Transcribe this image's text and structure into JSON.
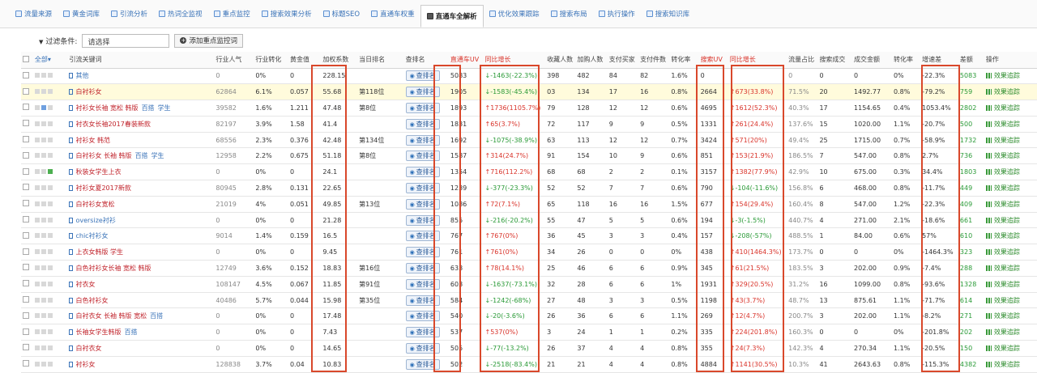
{
  "tabs": [
    {
      "label": "流量来源",
      "active": false
    },
    {
      "label": "黄金词库",
      "active": false
    },
    {
      "label": "引流分析",
      "active": false
    },
    {
      "label": "热词全监视",
      "active": false
    },
    {
      "label": "重点监控",
      "active": false
    },
    {
      "label": "搜索效果分析",
      "active": false
    },
    {
      "label": "标题SEO",
      "active": false
    },
    {
      "label": "直通车权重",
      "active": false
    },
    {
      "label": "直通车全解析",
      "active": true
    },
    {
      "label": "优化效果跟踪",
      "active": false
    },
    {
      "label": "搜索布局",
      "active": false
    },
    {
      "label": "执行操作",
      "active": false
    },
    {
      "label": "搜索知识库",
      "active": false
    }
  ],
  "filter": {
    "label": "过滤条件:",
    "select_value": "请选择",
    "add_button": "添加重点监控词"
  },
  "table": {
    "headers": [
      "全部",
      "引流关键词",
      "行业人气",
      "行业转化",
      "黄金值",
      "加权系数",
      "当日排名",
      "查排名",
      "直通车UV",
      "同比增长",
      "收藏人数",
      "加购人数",
      "支付买家",
      "支付件数",
      "转化率",
      "搜索UV",
      "同比增长",
      "流量占比",
      "搜索成交",
      "成交金额",
      "转化率",
      "增速差",
      "差额",
      "操作"
    ],
    "rank_button": "查排名",
    "op_label": "效果追踪",
    "rows": [
      {
        "kw": "其他",
        "kw_blue": true,
        "pop": "0",
        "conv": "0%",
        "gold": "0",
        "weight": "228.15",
        "rank": "",
        "uv": "5083",
        "uv_chg": "↓-1463(-22.3%)",
        "uv_up": false,
        "fav": "398",
        "cart": "482",
        "buyers": "84",
        "pieces": "82",
        "cvr": "1.6%",
        "suv": "0",
        "suv_chg": "",
        "suv_up": false,
        "share": "0",
        "sdeal": "0",
        "amount": "0",
        "cvr2": "0%",
        "speed": "-22.3%",
        "diff": "5083",
        "tags": [],
        "hl": false
      },
      {
        "kw": "白衬衫女",
        "kw_blue": false,
        "pop": "62864",
        "conv": "6.1%",
        "gold": "0.057",
        "weight": "55.68",
        "rank": "第118位",
        "uv": "1905",
        "uv_chg": "↓-1583(-45.4%)",
        "uv_up": false,
        "fav": "03",
        "cart": "134",
        "buyers": "17",
        "pieces": "16",
        "cvr": "0.8%",
        "suv": "2664",
        "suv_chg": "↑673(33.8%)",
        "suv_up": true,
        "share": "71.5%",
        "sdeal": "20",
        "amount": "1492.77",
        "cvr2": "0.8%",
        "speed": "-79.2%",
        "diff": "759",
        "tags": [],
        "hl": true
      },
      {
        "kw": "衬衫女长袖 宽松 韩版",
        "kw_blue": false,
        "pop": "39582",
        "conv": "1.6%",
        "gold": "1.211",
        "weight": "47.48",
        "rank": "第8位",
        "uv": "1893",
        "uv_chg": "↑1736(1105.7%)",
        "uv_up": true,
        "fav": "79",
        "cart": "128",
        "buyers": "12",
        "pieces": "12",
        "cvr": "0.6%",
        "suv": "4695",
        "suv_chg": "↑1612(52.3%)",
        "suv_up": true,
        "share": "40.3%",
        "sdeal": "17",
        "amount": "1154.65",
        "cvr2": "0.4%",
        "speed": "1053.4%",
        "diff": "2802",
        "tags": [
          "百搭",
          "学生"
        ],
        "hl": false
      },
      {
        "kw": "衬衣女长袖2017春装新款",
        "kw_blue": false,
        "pop": "82197",
        "conv": "3.9%",
        "gold": "1.58",
        "weight": "41.4",
        "rank": "",
        "uv": "1831",
        "uv_chg": "↑65(3.7%)",
        "uv_up": true,
        "fav": "72",
        "cart": "117",
        "buyers": "9",
        "pieces": "9",
        "cvr": "0.5%",
        "suv": "1331",
        "suv_chg": "↑261(24.4%)",
        "suv_up": true,
        "share": "137.6%",
        "sdeal": "15",
        "amount": "1020.00",
        "cvr2": "1.1%",
        "speed": "-20.7%",
        "diff": "500",
        "tags": [],
        "hl": false
      },
      {
        "kw": "衬衫女 韩范",
        "kw_blue": false,
        "pop": "68556",
        "conv": "2.3%",
        "gold": "0.376",
        "weight": "42.48",
        "rank": "第134位",
        "uv": "1692",
        "uv_chg": "↓-1075(-38.9%)",
        "uv_up": false,
        "fav": "63",
        "cart": "113",
        "buyers": "12",
        "pieces": "12",
        "cvr": "0.7%",
        "suv": "3424",
        "suv_chg": "↑571(20%)",
        "suv_up": true,
        "share": "49.4%",
        "sdeal": "25",
        "amount": "1715.00",
        "cvr2": "0.7%",
        "speed": "-58.9%",
        "diff": "1732",
        "tags": [],
        "hl": false
      },
      {
        "kw": "白衬衫女 长袖 韩版",
        "kw_blue": false,
        "pop": "12958",
        "conv": "2.2%",
        "gold": "0.675",
        "weight": "51.18",
        "rank": "第8位",
        "uv": "1587",
        "uv_chg": "↑314(24.7%)",
        "uv_up": true,
        "fav": "91",
        "cart": "154",
        "buyers": "10",
        "pieces": "9",
        "cvr": "0.6%",
        "suv": "851",
        "suv_chg": "↑153(21.9%)",
        "suv_up": true,
        "share": "186.5%",
        "sdeal": "7",
        "amount": "547.00",
        "cvr2": "0.8%",
        "speed": "2.7%",
        "diff": "736",
        "tags": [
          "百搭",
          "学生"
        ],
        "hl": false
      },
      {
        "kw": "秋装女学生上衣",
        "kw_blue": false,
        "pop": "0",
        "conv": "0%",
        "gold": "0",
        "weight": "24.1",
        "rank": "",
        "uv": "1354",
        "uv_chg": "↑716(112.2%)",
        "uv_up": true,
        "fav": "68",
        "cart": "68",
        "buyers": "2",
        "pieces": "2",
        "cvr": "0.1%",
        "suv": "3157",
        "suv_chg": "↑1382(77.9%)",
        "suv_up": true,
        "share": "42.9%",
        "sdeal": "10",
        "amount": "675.00",
        "cvr2": "0.3%",
        "speed": "34.4%",
        "diff": "1803",
        "tags": [],
        "hl": false
      },
      {
        "kw": "衬衫女夏2017新款",
        "kw_blue": false,
        "pop": "80945",
        "conv": "2.8%",
        "gold": "0.131",
        "weight": "22.65",
        "rank": "",
        "uv": "1239",
        "uv_chg": "↓-377(-23.3%)",
        "uv_up": false,
        "fav": "52",
        "cart": "52",
        "buyers": "7",
        "pieces": "7",
        "cvr": "0.6%",
        "suv": "790",
        "suv_chg": "↓-104(-11.6%)",
        "suv_up": false,
        "share": "156.8%",
        "sdeal": "6",
        "amount": "468.00",
        "cvr2": "0.8%",
        "speed": "-11.7%",
        "diff": "449",
        "tags": [],
        "hl": false
      },
      {
        "kw": "白衬衫女宽松",
        "kw_blue": false,
        "pop": "21019",
        "conv": "4%",
        "gold": "0.051",
        "weight": "49.85",
        "rank": "第13位",
        "uv": "1086",
        "uv_chg": "↑72(7.1%)",
        "uv_up": true,
        "fav": "65",
        "cart": "118",
        "buyers": "16",
        "pieces": "16",
        "cvr": "1.5%",
        "suv": "677",
        "suv_chg": "↑154(29.4%)",
        "suv_up": true,
        "share": "160.4%",
        "sdeal": "8",
        "amount": "547.00",
        "cvr2": "1.2%",
        "speed": "-22.3%",
        "diff": "409",
        "tags": [],
        "hl": false
      },
      {
        "kw": "oversize衬衫",
        "kw_blue": true,
        "pop": "0",
        "conv": "0%",
        "gold": "0",
        "weight": "21.28",
        "rank": "",
        "uv": "855",
        "uv_chg": "↓-216(-20.2%)",
        "uv_up": false,
        "fav": "55",
        "cart": "47",
        "buyers": "5",
        "pieces": "5",
        "cvr": "0.6%",
        "suv": "194",
        "suv_chg": "↓-3(-1.5%)",
        "suv_up": false,
        "share": "440.7%",
        "sdeal": "4",
        "amount": "271.00",
        "cvr2": "2.1%",
        "speed": "-18.6%",
        "diff": "661",
        "tags": [],
        "hl": false
      },
      {
        "kw": "chic衬衫女",
        "kw_blue": true,
        "pop": "9014",
        "conv": "1.4%",
        "gold": "0.159",
        "weight": "16.5",
        "rank": "",
        "uv": "767",
        "uv_chg": "↑767(0%)",
        "uv_up": true,
        "fav": "36",
        "cart": "45",
        "buyers": "3",
        "pieces": "3",
        "cvr": "0.4%",
        "suv": "157",
        "suv_chg": "↓-208(-57%)",
        "suv_up": false,
        "share": "488.5%",
        "sdeal": "1",
        "amount": "84.00",
        "cvr2": "0.6%",
        "speed": "57%",
        "diff": "610",
        "tags": [],
        "hl": false
      },
      {
        "kw": "上衣女韩版 学生",
        "kw_blue": false,
        "pop": "0",
        "conv": "0%",
        "gold": "0",
        "weight": "9.45",
        "rank": "",
        "uv": "761",
        "uv_chg": "↑761(0%)",
        "uv_up": true,
        "fav": "34",
        "cart": "26",
        "buyers": "0",
        "pieces": "0",
        "cvr": "0%",
        "suv": "438",
        "suv_chg": "↑410(1464.3%)",
        "suv_up": true,
        "share": "173.7%",
        "sdeal": "0",
        "amount": "0",
        "cvr2": "0%",
        "speed": "-1464.3%",
        "diff": "323",
        "tags": [],
        "hl": false
      },
      {
        "kw": "白色衬衫女长袖 宽松 韩版",
        "kw_blue": false,
        "pop": "12749",
        "conv": "3.6%",
        "gold": "0.152",
        "weight": "18.83",
        "rank": "第16位",
        "uv": "633",
        "uv_chg": "↑78(14.1%)",
        "uv_up": true,
        "fav": "25",
        "cart": "46",
        "buyers": "6",
        "pieces": "6",
        "cvr": "0.9%",
        "suv": "345",
        "suv_chg": "↑61(21.5%)",
        "suv_up": true,
        "share": "183.5%",
        "sdeal": "3",
        "amount": "202.00",
        "cvr2": "0.9%",
        "speed": "-7.4%",
        "diff": "288",
        "tags": [],
        "hl": false
      },
      {
        "kw": "衬衣女",
        "kw_blue": false,
        "pop": "108147",
        "conv": "4.5%",
        "gold": "0.067",
        "weight": "11.85",
        "rank": "第91位",
        "uv": "603",
        "uv_chg": "↓-1637(-73.1%)",
        "uv_up": false,
        "fav": "32",
        "cart": "28",
        "buyers": "6",
        "pieces": "6",
        "cvr": "1%",
        "suv": "1931",
        "suv_chg": "↑329(20.5%)",
        "suv_up": true,
        "share": "31.2%",
        "sdeal": "16",
        "amount": "1099.00",
        "cvr2": "0.8%",
        "speed": "-93.6%",
        "diff": "1328",
        "tags": [],
        "hl": false
      },
      {
        "kw": "白色衬衫女",
        "kw_blue": false,
        "pop": "40486",
        "conv": "5.7%",
        "gold": "0.044",
        "weight": "15.98",
        "rank": "第35位",
        "uv": "584",
        "uv_chg": "↓-1242(-68%)",
        "uv_up": false,
        "fav": "27",
        "cart": "48",
        "buyers": "3",
        "pieces": "3",
        "cvr": "0.5%",
        "suv": "1198",
        "suv_chg": "↑43(3.7%)",
        "suv_up": true,
        "share": "48.7%",
        "sdeal": "13",
        "amount": "875.61",
        "cvr2": "1.1%",
        "speed": "-71.7%",
        "diff": "614",
        "tags": [],
        "hl": false
      },
      {
        "kw": "白衬衣女 长袖 韩版 宽松",
        "kw_blue": false,
        "pop": "0",
        "conv": "0%",
        "gold": "0",
        "weight": "17.48",
        "rank": "",
        "uv": "540",
        "uv_chg": "↓-20(-3.6%)",
        "uv_up": false,
        "fav": "26",
        "cart": "36",
        "buyers": "6",
        "pieces": "6",
        "cvr": "1.1%",
        "suv": "269",
        "suv_chg": "↑12(4.7%)",
        "suv_up": true,
        "share": "200.7%",
        "sdeal": "3",
        "amount": "202.00",
        "cvr2": "1.1%",
        "speed": "-8.2%",
        "diff": "271",
        "tags": [
          "百搭"
        ],
        "hl": false
      },
      {
        "kw": "长袖女学生韩版",
        "kw_blue": false,
        "pop": "0",
        "conv": "0%",
        "gold": "0",
        "weight": "7.43",
        "rank": "",
        "uv": "537",
        "uv_chg": "↑537(0%)",
        "uv_up": true,
        "fav": "3",
        "cart": "24",
        "buyers": "1",
        "pieces": "1",
        "cvr": "0.2%",
        "suv": "335",
        "suv_chg": "↑224(201.8%)",
        "suv_up": true,
        "share": "160.3%",
        "sdeal": "0",
        "amount": "0",
        "cvr2": "0%",
        "speed": "-201.8%",
        "diff": "202",
        "tags": [
          "百搭"
        ],
        "hl": false
      },
      {
        "kw": "白衬衣女",
        "kw_blue": false,
        "pop": "0",
        "conv": "0%",
        "gold": "0",
        "weight": "14.65",
        "rank": "",
        "uv": "505",
        "uv_chg": "↓-77(-13.2%)",
        "uv_up": false,
        "fav": "26",
        "cart": "37",
        "buyers": "4",
        "pieces": "4",
        "cvr": "0.8%",
        "suv": "355",
        "suv_chg": "↑24(7.3%)",
        "suv_up": true,
        "share": "142.3%",
        "sdeal": "4",
        "amount": "270.34",
        "cvr2": "1.1%",
        "speed": "-20.5%",
        "diff": "150",
        "tags": [],
        "hl": false
      },
      {
        "kw": "衬衫女",
        "kw_blue": false,
        "pop": "128838",
        "conv": "3.7%",
        "gold": "0.04",
        "weight": "10.83",
        "rank": "",
        "uv": "502",
        "uv_chg": "↓-2518(-83.4%)",
        "uv_up": false,
        "fav": "21",
        "cart": "21",
        "buyers": "4",
        "pieces": "4",
        "cvr": "0.8%",
        "suv": "4884",
        "suv_chg": "↑1141(30.5%)",
        "suv_up": true,
        "share": "10.3%",
        "sdeal": "41",
        "amount": "2643.63",
        "cvr2": "0.8%",
        "speed": "-115.3%",
        "diff": "4382",
        "tags": [],
        "hl": false
      }
    ]
  },
  "colors": {
    "highlight_box": "#d9482b",
    "up": "#d9342b",
    "down": "#2a9a37",
    "link": "#3a73b8"
  }
}
